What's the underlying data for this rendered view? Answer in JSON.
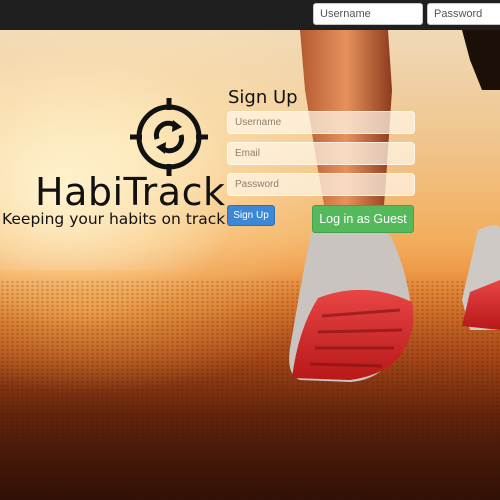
{
  "navbar": {
    "username_placeholder": "Username",
    "password_placeholder": "Password"
  },
  "brand": {
    "logo_icon": "crosshair-refresh-icon",
    "name": "HabiTrack",
    "tagline": "Keeping your habits on track"
  },
  "signup": {
    "title": "Sign Up",
    "username_placeholder": "Username",
    "email_placeholder": "Email",
    "password_placeholder": "Password",
    "signup_button": "Sign Up",
    "guest_button": "Log in as Guest"
  },
  "colors": {
    "navbar_bg": "#1f1f1f",
    "signup_button": "#3c87d6",
    "guest_button": "#53b95a"
  }
}
